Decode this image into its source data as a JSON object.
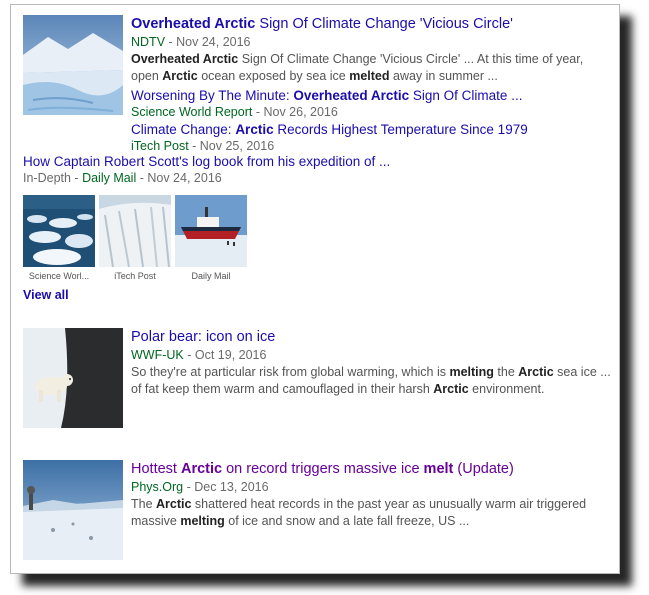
{
  "results": [
    {
      "title_parts": [
        {
          "text": "Overheated Arctic",
          "bold": true
        },
        {
          "text": " Sign Of Climate Change 'Vicious Circle'",
          "bold": false
        }
      ],
      "source": "NDTV",
      "date": " - Nov 24, 2016",
      "snippet_parts": [
        {
          "text": "Overheated Arctic",
          "bold": true
        },
        {
          "text": " Sign Of Climate Change 'Vicious Circle' ... At this time of year, open ",
          "bold": false
        },
        {
          "text": "Arctic",
          "bold": true
        },
        {
          "text": " ocean exposed by sea ice ",
          "bold": false
        },
        {
          "text": "melted",
          "bold": true
        },
        {
          "text": " away in summer ...",
          "bold": false
        }
      ],
      "related": [
        {
          "title_parts": [
            {
              "text": "Worsening By The Minute: ",
              "bold": false
            },
            {
              "text": "Overheated Arctic",
              "bold": true
            },
            {
              "text": " Sign Of Climate ...",
              "bold": false
            }
          ],
          "source": "Science World Report",
          "date": " - Nov 26, 2016"
        },
        {
          "title_parts": [
            {
              "text": "Climate Change: ",
              "bold": false
            },
            {
              "text": "Arctic",
              "bold": true
            },
            {
              "text": " Records Highest Temperature Since 1979",
              "bold": false
            }
          ],
          "source": "iTech Post",
          "date": " - Nov 25, 2016"
        }
      ],
      "extra_link": "How Captain Robert Scott's log book from his expedition of ...",
      "extra_meta_prefix": "In-Depth - ",
      "extra_source": "Daily Mail",
      "extra_date": " - Nov 24, 2016",
      "mini_images": [
        {
          "caption": "Science Worl..."
        },
        {
          "caption": "iTech Post"
        },
        {
          "caption": "Daily Mail"
        }
      ],
      "view_all": "View all"
    },
    {
      "title_parts": [
        {
          "text": "Polar bear: icon on ice",
          "bold": false
        }
      ],
      "source": "WWF-UK",
      "date": " - Oct 19, 2016",
      "snippet_parts": [
        {
          "text": "So they're at particular risk from global warming, which is ",
          "bold": false
        },
        {
          "text": "melting",
          "bold": true
        },
        {
          "text": " the ",
          "bold": false
        },
        {
          "text": "Arctic",
          "bold": true
        },
        {
          "text": " sea ice ... of fat keep them warm and camouflaged in their harsh ",
          "bold": false
        },
        {
          "text": "Arctic",
          "bold": true
        },
        {
          "text": " environment.",
          "bold": false
        }
      ]
    },
    {
      "title_parts": [
        {
          "text": "Hottest ",
          "bold": false
        },
        {
          "text": "Arctic",
          "bold": true
        },
        {
          "text": " on record triggers massive ice ",
          "bold": false
        },
        {
          "text": "melt",
          "bold": true
        },
        {
          "text": " (Update)",
          "bold": false
        }
      ],
      "source": "Phys.Org",
      "date": " - Dec 13, 2016",
      "snippet_parts": [
        {
          "text": "The ",
          "bold": false
        },
        {
          "text": "Arctic",
          "bold": true
        },
        {
          "text": " shattered heat records in the past year as unusually warm air triggered massive ",
          "bold": false
        },
        {
          "text": "melting",
          "bold": true
        },
        {
          "text": " of ice and snow and a late fall freeze, US ...",
          "bold": false
        }
      ]
    }
  ],
  "colors": {
    "link": "#1a0dab",
    "visited": "#660099",
    "source": "#006621",
    "snippet": "#545454"
  }
}
